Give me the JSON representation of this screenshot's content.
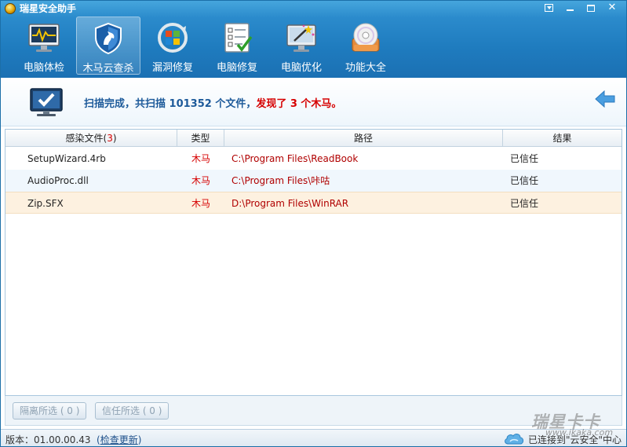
{
  "window": {
    "title": "瑞星安全助手"
  },
  "toolbar": {
    "items": [
      {
        "label": "电脑体检",
        "icon": "monitor-pulse-icon"
      },
      {
        "label": "木马云查杀",
        "icon": "shield-horse-icon",
        "active": true
      },
      {
        "label": "漏洞修复",
        "icon": "windows-refresh-icon"
      },
      {
        "label": "电脑修复",
        "icon": "checklist-icon"
      },
      {
        "label": "电脑优化",
        "icon": "magic-wand-monitor-icon"
      },
      {
        "label": "功能大全",
        "icon": "disc-toolbox-icon"
      }
    ]
  },
  "banner": {
    "msg_prefix": "扫描完成，共扫描 101352 个文件，",
    "msg_found": "发现了 3 个木马。"
  },
  "table": {
    "columns": {
      "file": "感染文件",
      "file_count_open": "(",
      "file_count": "3",
      "file_count_close": ")",
      "type": "类型",
      "path": "路径",
      "result": "结果"
    },
    "rows": [
      {
        "name": "SetupWizard.4rb",
        "type": "木马",
        "path": "C:\\Program Files\\ReadBook",
        "result": "已信任"
      },
      {
        "name": "AudioProc.dll",
        "type": "木马",
        "path": "C:\\Program Files\\咔咕",
        "result": "已信任"
      },
      {
        "name": "Zip.SFX",
        "type": "木马",
        "path": "D:\\Program Files\\WinRAR",
        "result": "已信任"
      }
    ]
  },
  "actions": {
    "isolate": "隔离所选 ( 0 )",
    "trust": "信任所选 ( 0 )"
  },
  "statusbar": {
    "version": "版本：01.00.00.43",
    "update_open": "(",
    "update_link": "检查更新",
    "update_close": ")",
    "connection": "已连接到\"云安全\"中心"
  },
  "watermark": {
    "brand": "瑞星卡卡",
    "url": "www.ikaka.com"
  },
  "colors": {
    "accent": "#1f7cbf",
    "alert": "#d60000",
    "selected_row": "#fdf1e0"
  }
}
